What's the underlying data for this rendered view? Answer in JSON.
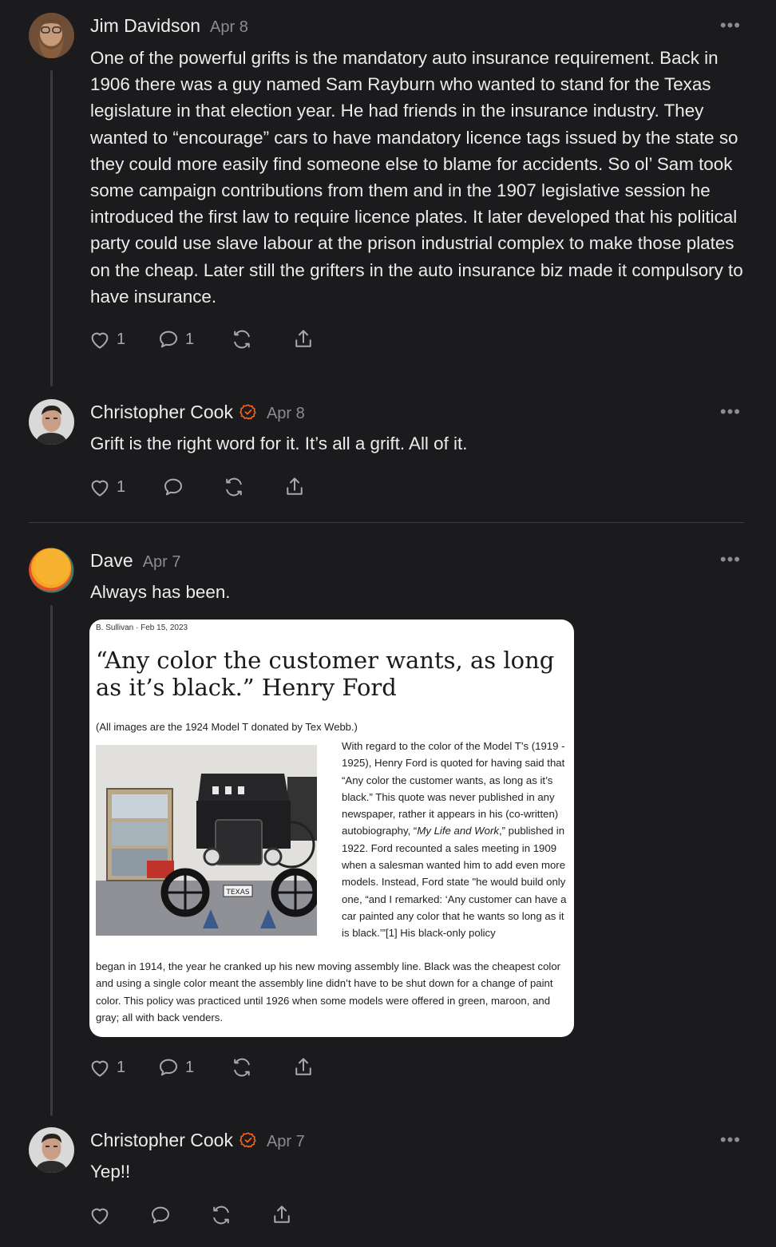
{
  "comments": [
    {
      "author": "Jim Davidson",
      "date": "Apr 8",
      "text": "One of the powerful grifts is the mandatory auto insurance requirement. Back in 1906 there was a guy named Sam Rayburn who wanted to stand for the Texas legislature in that election year. He had friends in the insurance industry. They wanted to “encourage” cars to have mandatory licence tags issued by the state so they could more easily find someone else to blame for accidents. So ol’ Sam took some campaign contributions from them and in the 1907 legislative session he introduced the first law to require licence plates. It later developed that his political party could use slave labour at the prison industrial complex to make those plates on the cheap. Later still the grifters in the auto insurance biz made it compulsory to have insurance.",
      "likes": "1",
      "replies": "1"
    },
    {
      "author": "Christopher Cook",
      "date": "Apr 8",
      "text": "Grift is the right word for it. It’s all a grift. All of it.",
      "likes": "1"
    },
    {
      "author": "Dave",
      "date": "Apr 7",
      "text": "Always has been.",
      "likes": "1",
      "replies": "1",
      "attachment": {
        "meta": "B. Sullivan · Feb 15, 2023",
        "title": "“Any color the customer wants, as long as it’s black.” Henry Ford",
        "caption": "(All images are the 1924 Model T donated by Tex Webb.)",
        "plate": "TEXAS",
        "side_pre": "With regard to the color of the Model T’s (1919 - 1925), Henry Ford is quoted for having said that “Any color the customer wants, as long as it’s black.” This quote was never published in any newspaper, rather it appears in his (co-written) autobiography, “",
        "side_italic": "My Life and Work",
        "side_post": ",” published in 1922. Ford recounted a sales meeting in 1909 when a salesman wanted him to add even more models. Instead, Ford state \"he would build only one, “and I remarked: ‘Any customer can have a car painted any color that he wants so long as it is black.’”[1]  His black-only policy",
        "bottom": "began in 1914, the year he cranked up his new moving assembly line.  Black was the cheapest color and using a single color meant the assembly line didn’t have to be shut down for a change of paint color.  This policy was practiced until 1926 when some models were offered in green, maroon, and gray; all with back venders."
      }
    },
    {
      "author": "Christopher Cook",
      "date": "Apr 7",
      "text": "Yep!!"
    }
  ],
  "colors": {
    "background": "#1b1b1d",
    "text": "#ececec",
    "muted": "#8c8c90",
    "accent": "#ff6719",
    "thread_line": "#3a3a3c"
  },
  "icons": [
    "more-icon",
    "heart-icon",
    "comment-icon",
    "restack-icon",
    "share-icon",
    "verified-badge-icon"
  ]
}
